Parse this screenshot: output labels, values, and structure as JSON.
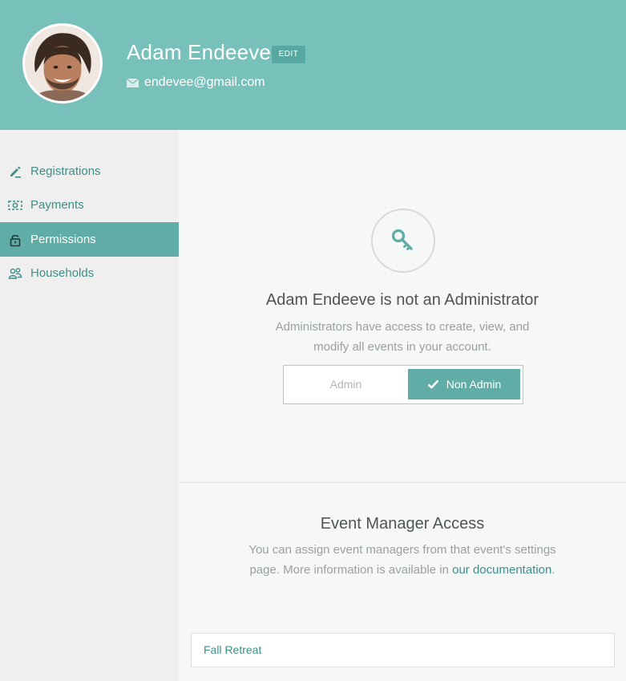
{
  "header": {
    "user_name": "Adam Endeeve",
    "edit_label": "EDIT",
    "email": "endevee@gmail.com",
    "accent_color": "#78c1ba"
  },
  "sidebar": {
    "items": [
      {
        "label": "Registrations",
        "icon": "pencil-icon",
        "active": false
      },
      {
        "label": "Payments",
        "icon": "money-icon",
        "active": false
      },
      {
        "label": "Permissions",
        "icon": "lock-icon",
        "active": true
      },
      {
        "label": "Households",
        "icon": "people-icon",
        "active": false
      }
    ]
  },
  "permissions": {
    "icon": "key-icon",
    "title": "Adam Endeeve is not an Administrator",
    "description": "Administrators have access to create, view, and modify all events in your account.",
    "toggle": {
      "admin_label": "Admin",
      "non_admin_label": "Non Admin",
      "selected": "Non Admin"
    }
  },
  "event_manager": {
    "title": "Event Manager Access",
    "description_prefix": "You can assign event managers from that event's settings page. More information is available in ",
    "link_text": "our documentation",
    "description_suffix": ".",
    "events": [
      {
        "name": "Fall Retreat"
      }
    ]
  }
}
